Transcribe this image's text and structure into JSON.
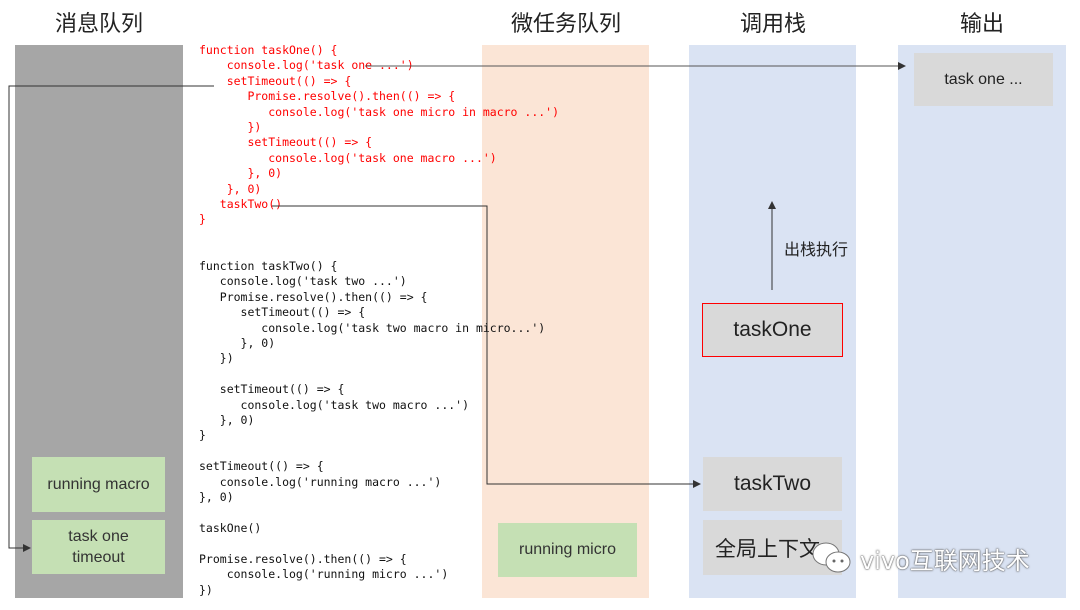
{
  "titles": {
    "message_queue": "消息队列",
    "microtask_queue": "微任务队列",
    "call_stack": "调用栈",
    "output": "输出"
  },
  "message_queue": [
    "running macro",
    "task one\ntimeout"
  ],
  "microtask_queue": [
    "running micro"
  ],
  "call_stack": {
    "top": "taskOne",
    "items": [
      "taskTwo",
      "全局上下文"
    ],
    "pop_label": "出栈执行"
  },
  "output": [
    "task one ..."
  ],
  "code_red": "function taskOne() {\n    console.log('task one ...')\n    setTimeout(() => {\n       Promise.resolve().then(() => {\n          console.log('task one micro in macro ...')\n       })\n       setTimeout(() => {\n          console.log('task one macro ...')\n       }, 0)\n    }, 0)\n   taskTwo()\n}",
  "code_black": "function taskTwo() {\n   console.log('task two ...')\n   Promise.resolve().then(() => {\n      setTimeout(() => {\n         console.log('task two macro in micro...')\n      }, 0)\n   })\n\n   setTimeout(() => {\n      console.log('task two macro ...')\n   }, 0)\n}\n\nsetTimeout(() => {\n   console.log('running macro ...')\n}, 0)\n\ntaskOne()\n\nPromise.resolve().then(() => {\n    console.log('running micro ...')\n})",
  "watermark": "vivo互联网技术",
  "colors": {
    "message_queue_bg": "#a6a6a6",
    "microtask_bg": "#fbe5d6",
    "stack_bg": "#dae3f3",
    "green_box": "#c5e0b4",
    "grey_box": "#d9d9d9",
    "highlight": "#ff0000"
  }
}
